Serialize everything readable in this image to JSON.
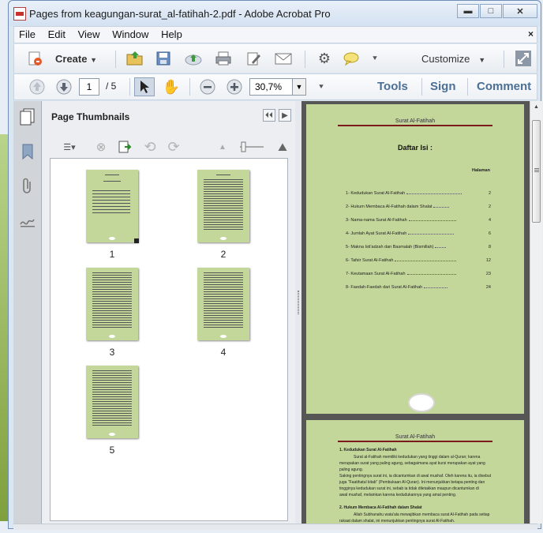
{
  "window": {
    "title": "Pages from keagungan-surat_al-fatihah-2.pdf - Adobe Acrobat Pro",
    "controls": [
      "minimize",
      "maximize",
      "close"
    ]
  },
  "menu": {
    "items": [
      {
        "label": "File"
      },
      {
        "label": "Edit"
      },
      {
        "label": "View"
      },
      {
        "label": "Window"
      },
      {
        "label": "Help"
      }
    ],
    "close_label": "×"
  },
  "toolbar": {
    "create_label": "Create",
    "customize_label": "Customize"
  },
  "nav": {
    "current_page": "1",
    "page_count": "/ 5",
    "zoom": "30,7%",
    "tools_label": "Tools",
    "sign_label": "Sign",
    "comment_label": "Comment"
  },
  "thumbnails": {
    "title": "Page Thumbnails",
    "pages": [
      {
        "label": "1"
      },
      {
        "label": "2"
      },
      {
        "label": "3"
      },
      {
        "label": "4"
      },
      {
        "label": "5"
      }
    ]
  },
  "document": {
    "page1": {
      "header": "Surat Al-Fatihah",
      "title": "Daftar Isi :",
      "halaman": "Halaman",
      "toc": [
        {
          "num": "1-",
          "text": "Kedudukan Surat Al-Fatihah",
          "page": "2"
        },
        {
          "num": "2-",
          "text": "Hukum Membaca Al-Fatihah dalam Shalat",
          "page": "2"
        },
        {
          "num": "3-",
          "text": "Nama-nama Surat Al-Fatihah",
          "page": "4"
        },
        {
          "num": "4-",
          "text": "Jumlah Ayat Surat Al-Fatihah",
          "page": "6"
        },
        {
          "num": "5-",
          "text": "Makna Isti'adzah dan Basmalah (Bismillah)",
          "page": "8"
        },
        {
          "num": "6-",
          "text": "Tafsir Surat Al-Fatihah",
          "page": "12"
        },
        {
          "num": "7-",
          "text": "Keutamaan Surat Al-Fatihah",
          "page": "23"
        },
        {
          "num": "8-",
          "text": "Faedah-Faedah dari Surat Al-Fatihah",
          "page": "24"
        }
      ]
    },
    "page2": {
      "header": "Surat Al-Fatihah",
      "lines": [
        {
          "text": "1.  Kedudukan Surat Al-Fatihah",
          "bold": true
        },
        {
          "text": "Surat al-Fatihah memiliki kedudukan yang tinggi dalam al-Quran; karena",
          "bold": false
        },
        {
          "text": "merupakan surat yang paling agung, sebagaimana ayat kursi merupakan ayat yang",
          "bold": false
        },
        {
          "text": "paling agung.",
          "bold": false
        },
        {
          "text": "Saking pentingnya surat ini, ia dicantumkan di awal mushaf. Oleh karena itu, ia disebut",
          "bold": false
        },
        {
          "text": "juga \"Faatihatul kitab\" (Pembukaan Al-Quran). Ini menunjukkan betapa penting dan",
          "bold": false
        },
        {
          "text": "tingginya kedudukan surat ini, sebab ia tidak diletakkan maupun dicantumkan di",
          "bold": false
        },
        {
          "text": "awal mushaf, melainkan karena kedudukannya yang amat penting.",
          "bold": false
        },
        {
          "text": "2.  Hukum Membaca Al-Fatihah dalam Shalat",
          "bold": true
        },
        {
          "text": "Allah Subhanahu wata'ala mewajibkan membaca surat Al-Fatihah pada setiap",
          "bold": false
        },
        {
          "text": "rakaat dalam shalat, ini menunjukkan pentingnya surat Al-Fatihah.",
          "bold": false
        }
      ]
    }
  }
}
